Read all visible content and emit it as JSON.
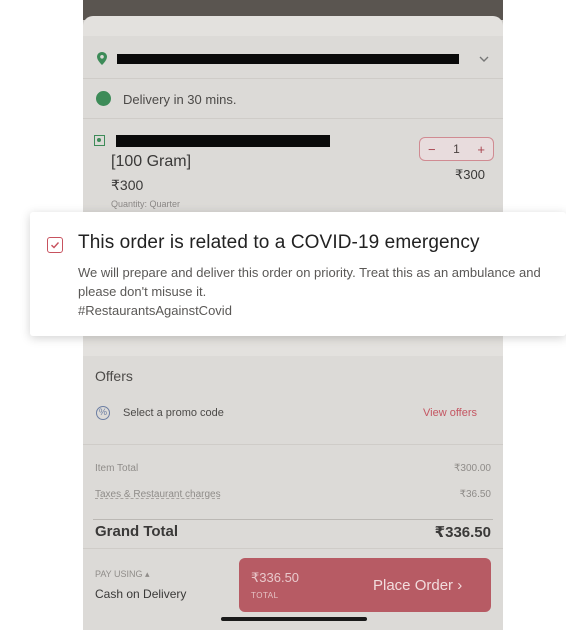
{
  "delivery": {
    "text": "Delivery in 30 mins."
  },
  "item": {
    "variant": "[100 Gram]",
    "price": "₹300",
    "quantity_note": "Quantity: Quarter",
    "stepper": {
      "minus": "−",
      "value": "1",
      "plus": "+"
    },
    "line_total": "₹300"
  },
  "popup": {
    "title": "This order is related to a COVID-19 emergency",
    "description": "We will prepare and deliver this order on priority. Treat this as an ambulance and please don't misuse it.",
    "hashtag": "#RestaurantsAgainstCovid"
  },
  "offers": {
    "title": "Offers",
    "promo_label": "Select a promo code",
    "view_offers": "View offers"
  },
  "bill": {
    "item_total_label": "Item Total",
    "item_total_value": "₹300.00",
    "taxes_label": "Taxes & Restaurant charges",
    "taxes_value": "₹36.50",
    "grand_total_label": "Grand Total",
    "grand_total_value": "₹336.50"
  },
  "payment": {
    "pay_using": "PAY USING ▴",
    "method": "Cash on Delivery",
    "amount": "₹336.50",
    "total_caption": "TOTAL",
    "place_order": "Place Order ›"
  },
  "colors": {
    "accent": "#c7525e",
    "veg_green": "#3d8b58",
    "button": "#b75b64"
  }
}
